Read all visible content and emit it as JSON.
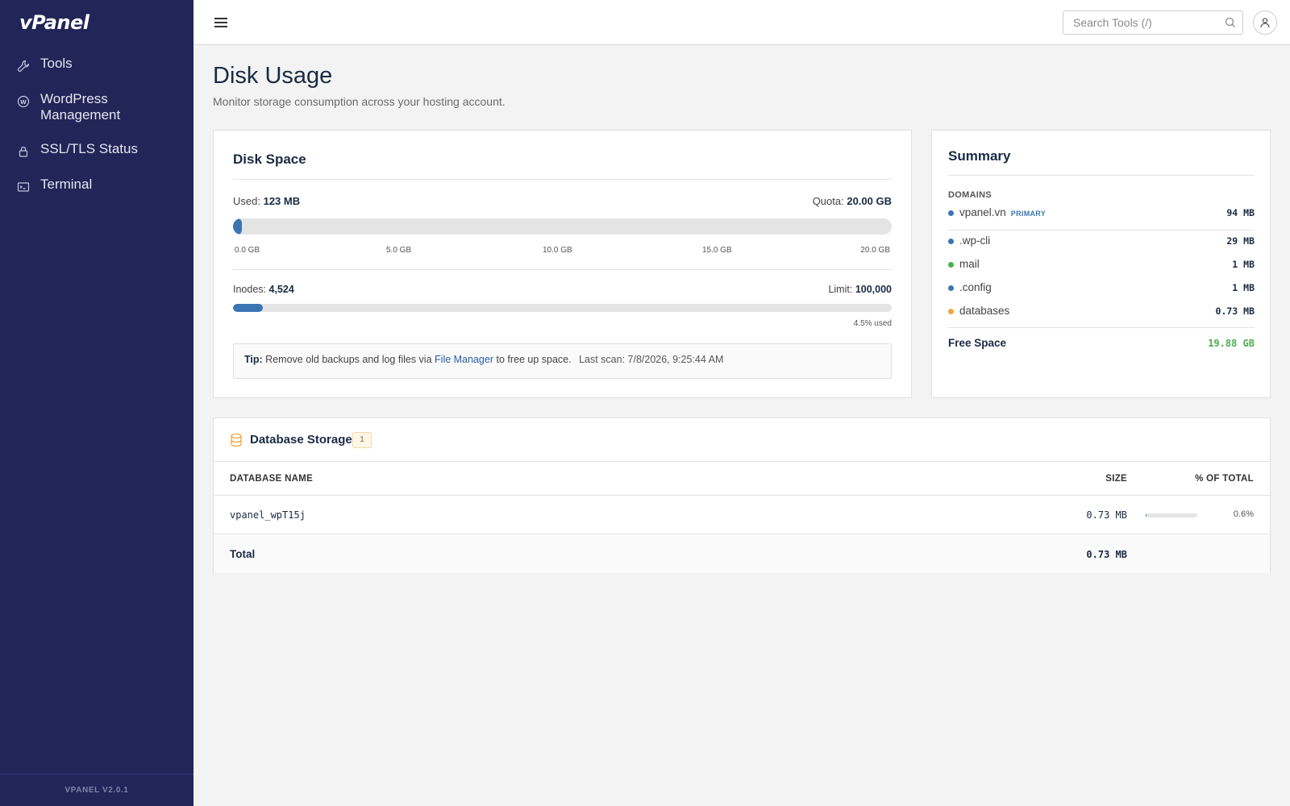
{
  "brand": {
    "logo_text": "vPanel",
    "version": "VPANEL V2.0.1"
  },
  "sidebar": {
    "items": [
      {
        "label": "Tools",
        "icon": "wrench-icon"
      },
      {
        "label": "WordPress Management",
        "icon": "wordpress-icon"
      },
      {
        "label": "SSL/TLS Status",
        "icon": "lock-icon"
      },
      {
        "label": "Terminal",
        "icon": "terminal-icon"
      }
    ]
  },
  "topbar": {
    "search_placeholder": "Search Tools (/)",
    "search_value": ""
  },
  "page": {
    "title": "Disk Usage",
    "subtitle": "Monitor storage consumption across your hosting account."
  },
  "disk_space": {
    "title": "Disk Space",
    "used_label": "Used:",
    "used_value": "123 MB",
    "quota_label": "Quota:",
    "quota_value": "20.00 GB",
    "used_fraction": 0.006,
    "ticks": [
      "0.0 GB",
      "5.0 GB",
      "10.0 GB",
      "15.0 GB",
      "20.0 GB"
    ],
    "inodes_label": "Inodes:",
    "inodes_value": "4,524",
    "limit_label": "Limit:",
    "limit_value": "100,000",
    "inodes_fraction": 0.045,
    "inodes_used_text": "4.5% used",
    "tip_label": "Tip:",
    "tip_text_before": "Remove old backups and log files via",
    "tip_link": "File Manager",
    "tip_text_after": "to free up space.",
    "last_scan": "Last scan: 7/8/2026, 9:25:44 AM"
  },
  "summary": {
    "title": "Summary",
    "domains_label": "DOMAINS",
    "primary_badge": "PRIMARY",
    "rows": [
      {
        "name": "vpanel.vn",
        "size": "94 MB",
        "color": "#3b75b3",
        "primary": true
      },
      {
        "name": ".wp-cli",
        "size": "29 MB",
        "color": "#3b75b3"
      },
      {
        "name": "mail",
        "size": "1 MB",
        "color": "#4caf50"
      },
      {
        "name": ".config",
        "size": "1 MB",
        "color": "#3b75b3"
      },
      {
        "name": "databases",
        "size": "0.73 MB",
        "color": "#f0a640"
      }
    ],
    "free_label": "Free Space",
    "free_value": "19.88 GB"
  },
  "database_storage": {
    "title": "Database Storage",
    "count": "1",
    "columns": [
      "DATABASE NAME",
      "SIZE",
      "% OF TOTAL"
    ],
    "rows": [
      {
        "name": "vpanel_wpT15j",
        "size": "0.73 MB",
        "percent": "0.6%",
        "fraction": 0.006
      }
    ],
    "total_label": "Total",
    "total_size": "0.73 MB"
  },
  "colors": {
    "sidebar_bg": "#212557",
    "accent": "#3b75b3",
    "free_green": "#4caf50",
    "database_orange": "#f0a640"
  }
}
